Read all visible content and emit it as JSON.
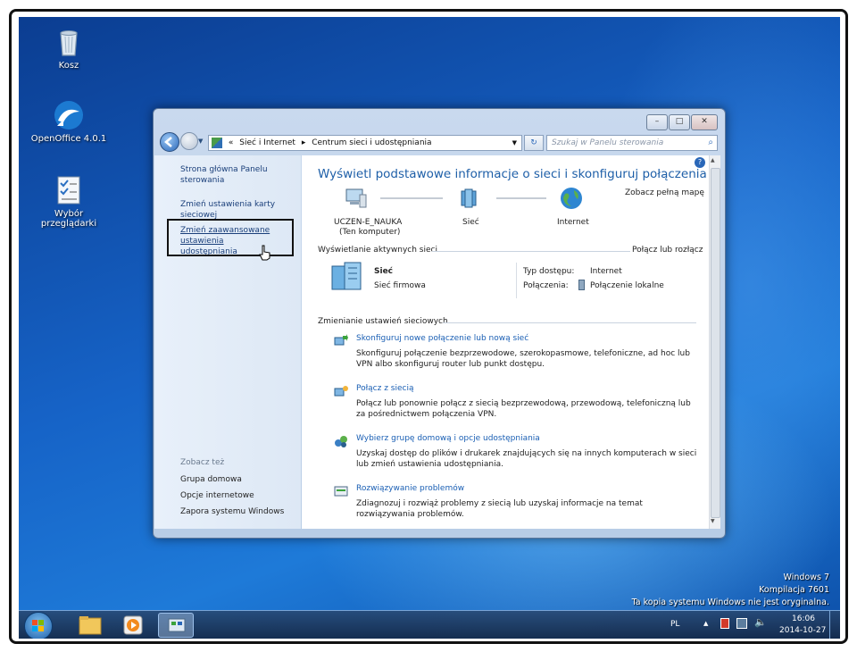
{
  "desktop": {
    "icons": [
      {
        "label": "Kosz"
      },
      {
        "label": "OpenOffice 4.0.1"
      },
      {
        "label": "Wybór przeglądarki"
      }
    ],
    "watermark": {
      "line1": "Windows 7",
      "line2": "Kompilacja 7601",
      "line3": "Ta kopia systemu Windows nie jest oryginalna."
    }
  },
  "window": {
    "controls": {
      "minimize": "–",
      "maximize": "□",
      "close": "✕"
    },
    "address": {
      "prefix": "«",
      "crumb1": "Sieć i Internet",
      "sep": "▸",
      "crumb2": "Centrum sieci i udostępniania"
    },
    "search_placeholder": "Szukaj w Panelu sterowania",
    "sidebar": {
      "link1": "Strona główna Panelu sterowania",
      "link2": "Zmień ustawienia karty sieciowej",
      "link3": "Zmień zaawansowane ustawienia udostępniania",
      "see_also": "Zobacz też",
      "see1": "Grupa domowa",
      "see2": "Opcje internetowe",
      "see3": "Zapora systemu Windows"
    },
    "main": {
      "title": "Wyświetl podstawowe informacje o sieci i skonfiguruj połączenia",
      "full_map": "Zobacz pełną mapę",
      "computer_name": "UCZEN-E_NAUKA",
      "computer_sub": "(Ten komputer)",
      "network_label": "Sieć",
      "internet_label": "Internet",
      "active_header": "Wyświetlanie aktywnych sieci",
      "connect_disconnect": "Połącz lub rozłącz",
      "active_name": "Sieć",
      "active_type": "Sieć firmowa",
      "access_label": "Typ dostępu:",
      "access_value": "Internet",
      "conn_label": "Połączenia:",
      "conn_value": "Połączenie lokalne",
      "change_header": "Zmienianie ustawień sieciowych",
      "tasks": [
        {
          "title": "Skonfiguruj nowe połączenie lub nową sieć",
          "desc": "Skonfiguruj połączenie bezprzewodowe, szerokopasmowe, telefoniczne, ad hoc lub VPN albo skonfiguruj router lub punkt dostępu."
        },
        {
          "title": "Połącz z siecią",
          "desc": "Połącz lub ponownie połącz z siecią bezprzewodową, przewodową, telefoniczną lub za pośrednictwem połączenia VPN."
        },
        {
          "title": "Wybierz grupę domową i opcje udostępniania",
          "desc": "Uzyskaj dostęp do plików i drukarek znajdujących się na innych komputerach w sieci lub zmień ustawienia udostępniania."
        },
        {
          "title": "Rozwiązywanie problemów",
          "desc": "Zdiagnozuj i rozwiąż problemy z siecią lub uzyskaj informacje na temat rozwiązywania problemów."
        }
      ]
    }
  },
  "taskbar": {
    "lang": "PL",
    "time": "16:06",
    "date": "2014-10-27"
  }
}
